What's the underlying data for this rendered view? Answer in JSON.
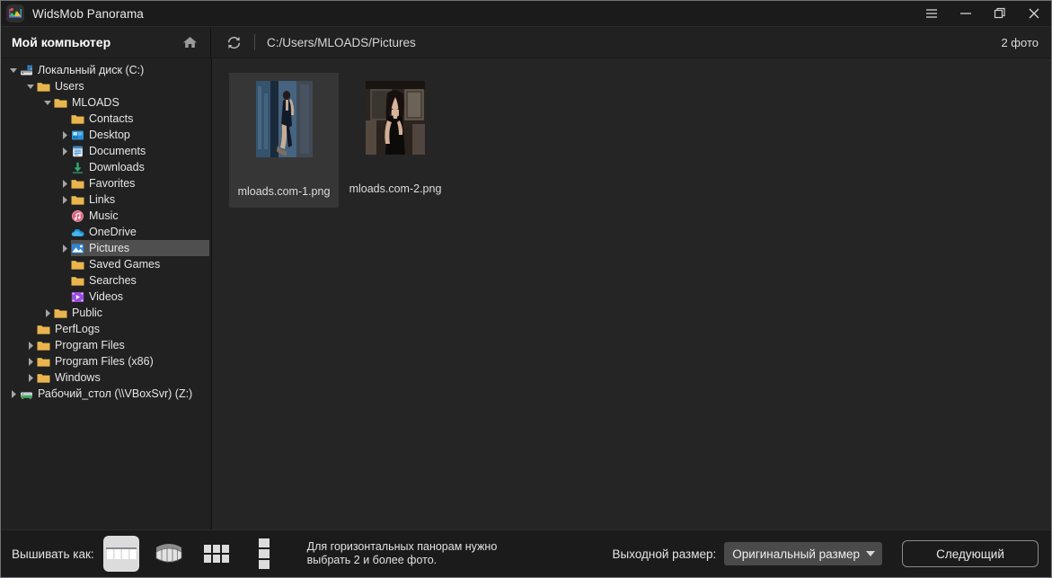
{
  "window": {
    "title": "WidsMob Panorama",
    "app_icon": "panorama-icon",
    "controls": [
      {
        "name": "menu-button",
        "icon": "hamburger-icon"
      },
      {
        "name": "minimize-button",
        "icon": "minimize-icon"
      },
      {
        "name": "maximize-button",
        "icon": "restore-icon"
      },
      {
        "name": "close-button",
        "icon": "close-icon"
      }
    ]
  },
  "subheader": {
    "sidebar_title": "Мой компьютер",
    "home_icon": "home-icon",
    "refresh_icon": "refresh-icon",
    "path": "C:/Users/MLOADS/Pictures",
    "photo_count": "2 фото"
  },
  "sidebar": {
    "tree": [
      {
        "label": "Локальный диск (C:)",
        "depth": 0,
        "icon": "drive-icon",
        "twisty": "down",
        "selected": false
      },
      {
        "label": "Users",
        "depth": 1,
        "icon": "folder-icon",
        "twisty": "down",
        "selected": false
      },
      {
        "label": "MLOADS",
        "depth": 2,
        "icon": "folder-icon",
        "twisty": "down",
        "selected": false
      },
      {
        "label": "Contacts",
        "depth": 3,
        "icon": "folder-icon",
        "twisty": "none",
        "selected": false
      },
      {
        "label": "Desktop",
        "depth": 3,
        "icon": "desktop-icon",
        "twisty": "right",
        "selected": false
      },
      {
        "label": "Documents",
        "depth": 3,
        "icon": "documents-icon",
        "twisty": "right",
        "selected": false
      },
      {
        "label": "Downloads",
        "depth": 3,
        "icon": "downloads-icon",
        "twisty": "none",
        "selected": false
      },
      {
        "label": "Favorites",
        "depth": 3,
        "icon": "folder-icon",
        "twisty": "right",
        "selected": false
      },
      {
        "label": "Links",
        "depth": 3,
        "icon": "folder-icon",
        "twisty": "right",
        "selected": false
      },
      {
        "label": "Music",
        "depth": 3,
        "icon": "music-icon",
        "twisty": "none",
        "selected": false
      },
      {
        "label": "OneDrive",
        "depth": 3,
        "icon": "onedrive-icon",
        "twisty": "none",
        "selected": false
      },
      {
        "label": "Pictures",
        "depth": 3,
        "icon": "pictures-icon",
        "twisty": "right",
        "selected": true
      },
      {
        "label": "Saved Games",
        "depth": 3,
        "icon": "folder-icon",
        "twisty": "none",
        "selected": false
      },
      {
        "label": "Searches",
        "depth": 3,
        "icon": "folder-icon",
        "twisty": "none",
        "selected": false
      },
      {
        "label": "Videos",
        "depth": 3,
        "icon": "videos-icon",
        "twisty": "none",
        "selected": false
      },
      {
        "label": "Public",
        "depth": 2,
        "icon": "folder-icon",
        "twisty": "right",
        "selected": false
      },
      {
        "label": "PerfLogs",
        "depth": 1,
        "icon": "folder-icon",
        "twisty": "none",
        "selected": false
      },
      {
        "label": "Program Files",
        "depth": 1,
        "icon": "folder-icon",
        "twisty": "right",
        "selected": false
      },
      {
        "label": "Program Files (x86)",
        "depth": 1,
        "icon": "folder-icon",
        "twisty": "right",
        "selected": false
      },
      {
        "label": "Windows",
        "depth": 1,
        "icon": "folder-icon",
        "twisty": "right",
        "selected": false
      },
      {
        "label": "Рабочий_стол (\\\\VBoxSvr) (Z:)",
        "depth": 0,
        "icon": "network-drive-icon",
        "twisty": "right",
        "selected": false
      }
    ]
  },
  "content": {
    "thumbnails": [
      {
        "name": "mloads.com-1.png",
        "selected": true
      },
      {
        "name": "mloads.com-2.png",
        "selected": false
      }
    ]
  },
  "bottombar": {
    "stitch_label": "Вышивать как:",
    "modes": [
      {
        "name": "mode-horizontal",
        "icon": "horizontal-panorama-icon",
        "active": true
      },
      {
        "name": "mode-360",
        "icon": "curved-panorama-icon",
        "active": false
      },
      {
        "name": "mode-tile",
        "icon": "tile-panorama-icon",
        "active": false
      },
      {
        "name": "mode-vertical",
        "icon": "vertical-panorama-icon",
        "active": false
      }
    ],
    "hint": "Для горизонтальных панорам нужно\nвыбрать 2 и более фото.",
    "output_size_label": "Выходной размер:",
    "output_size_value": "Оригинальный размер",
    "next_label": "Следующий"
  },
  "colors": {
    "window_bg": "#1e1e1e",
    "panel_bg": "#212121",
    "content_bg": "#252525",
    "selection": "#4f4f4f",
    "tile_selected": "#363636",
    "folder_yellow": "#f0bf5a",
    "text": "#e6e6e6"
  }
}
